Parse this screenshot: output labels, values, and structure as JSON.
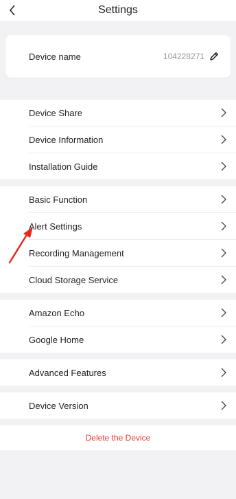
{
  "header": {
    "title": "Settings"
  },
  "device": {
    "name_label": "Device name",
    "name_value": "104228271"
  },
  "sections": [
    [
      {
        "id": "device-share",
        "label": "Device Share"
      },
      {
        "id": "device-information",
        "label": "Device Information"
      },
      {
        "id": "installation-guide",
        "label": "Installation Guide"
      }
    ],
    [
      {
        "id": "basic-function",
        "label": "Basic Function"
      },
      {
        "id": "alert-settings",
        "label": "Alert Settings"
      },
      {
        "id": "recording-management",
        "label": "Recording Management"
      },
      {
        "id": "cloud-storage-service",
        "label": "Cloud Storage Service"
      }
    ],
    [
      {
        "id": "amazon-echo",
        "label": "Amazon Echo"
      },
      {
        "id": "google-home",
        "label": "Google Home"
      }
    ],
    [
      {
        "id": "advanced-features",
        "label": "Advanced Features"
      }
    ],
    [
      {
        "id": "device-version",
        "label": "Device Version"
      }
    ]
  ],
  "delete_label": "Delete the Device",
  "colors": {
    "background": "#f2f2f4",
    "danger": "#e53935",
    "annotation": "#e8281e"
  },
  "icons": {
    "back": "chevron-left-icon",
    "edit": "pencil-icon",
    "row": "chevron-right-icon"
  }
}
